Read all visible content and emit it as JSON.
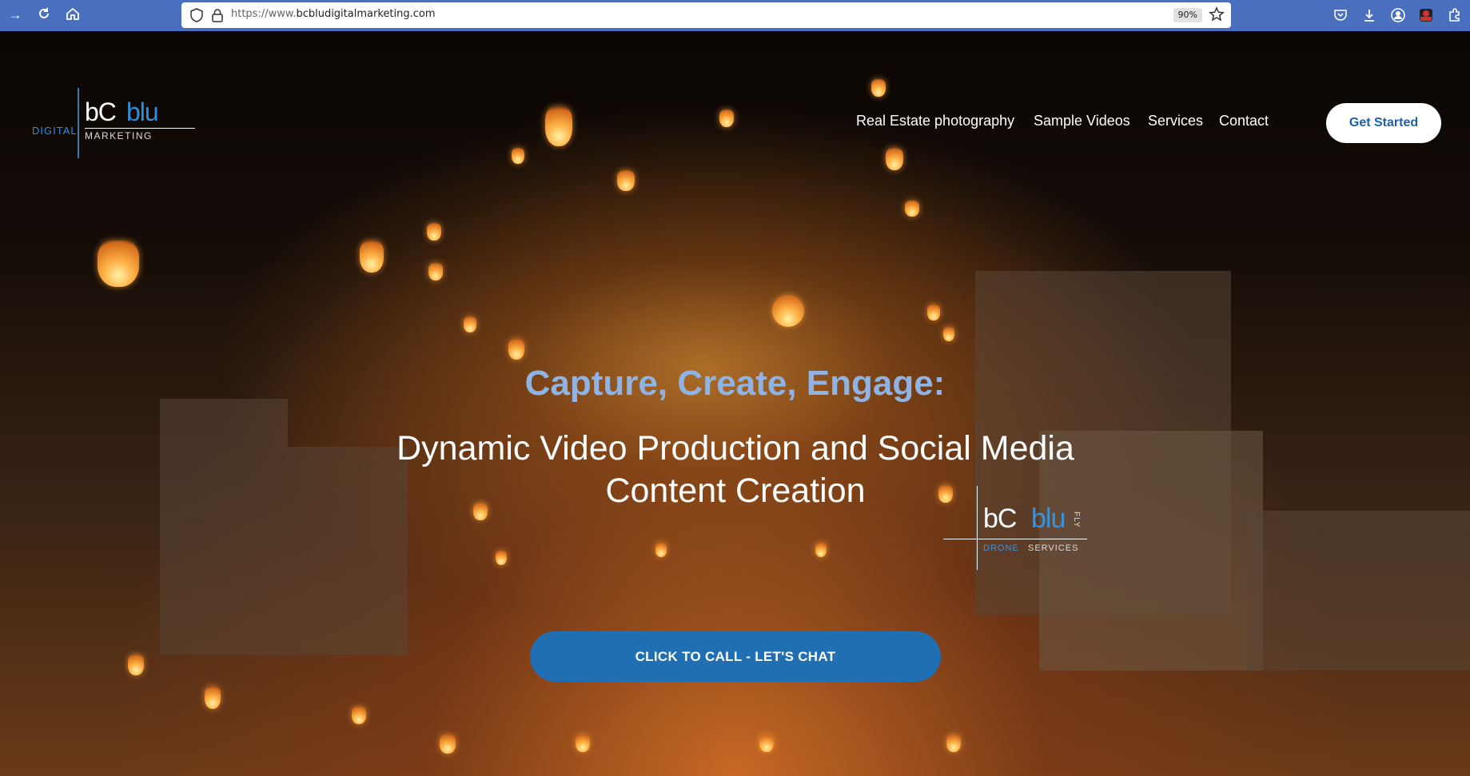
{
  "browser": {
    "url_protocol": "https://www.",
    "url_domain": "bcbludigitalmarketing.com",
    "zoom": "90%"
  },
  "logo": {
    "bc": "bC",
    "blu": "blu",
    "digital": "DIGITAL",
    "marketing": "MARKETING"
  },
  "nav": {
    "items": [
      "Real Estate photography",
      "Sample Videos",
      "Services",
      "Contact"
    ],
    "cta": "Get Started"
  },
  "hero": {
    "headline": "Capture, Create, Engage:",
    "subheadline": "Dynamic Video Production and Social Media Content Creation",
    "drone_logo": {
      "bc": "bC",
      "blu": "blu",
      "fly": "FLY",
      "drone": "DRONE",
      "services": "SERVICES"
    },
    "cta": "CLICK TO CALL - LET'S CHAT"
  },
  "colors": {
    "brand_blue": "#1f6fb2",
    "headline_blue": "#8fb3e3",
    "chrome_blue": "#4a6fbf"
  }
}
